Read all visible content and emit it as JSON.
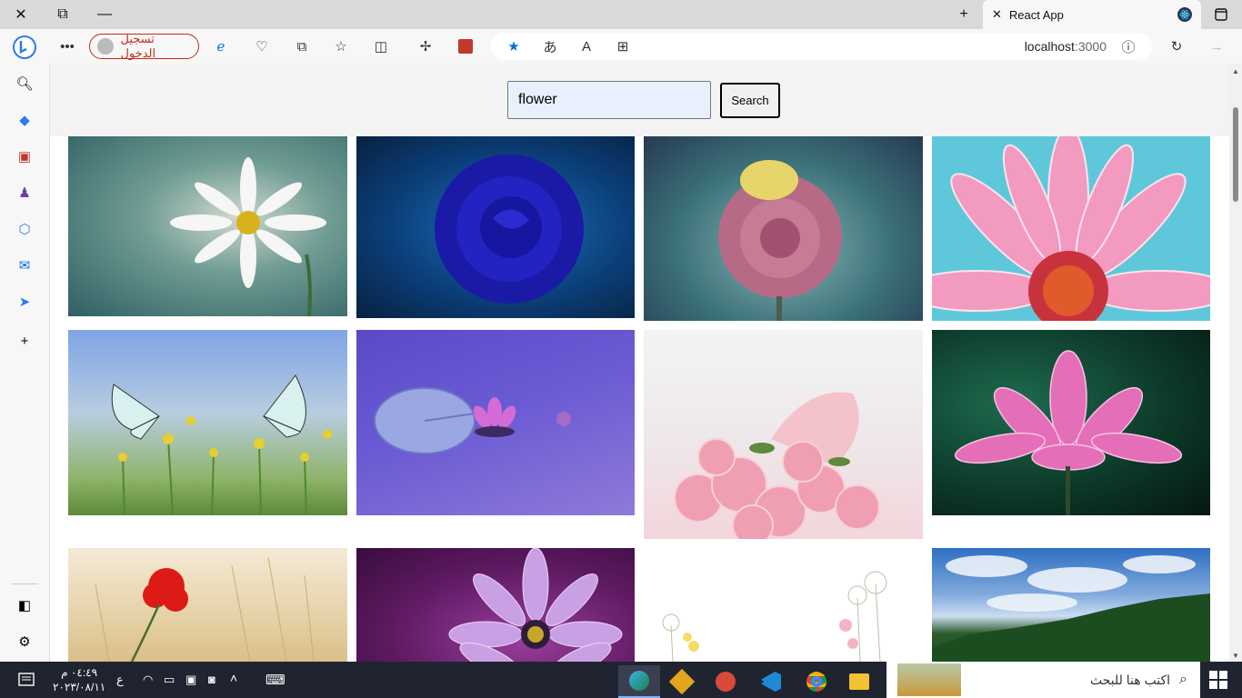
{
  "browser": {
    "tab_title": "React App",
    "signin_label": "تسجيل الدخول",
    "url_host": "localhost",
    "url_port": ":3000"
  },
  "search": {
    "value": "flower",
    "button_label": "Search"
  },
  "taskbar": {
    "search_placeholder": "اكتب هنا للبحث",
    "time": "٠٤:٤٩ م",
    "date": "٢٠٢٣/٠٨/١١",
    "lang": "ع"
  }
}
